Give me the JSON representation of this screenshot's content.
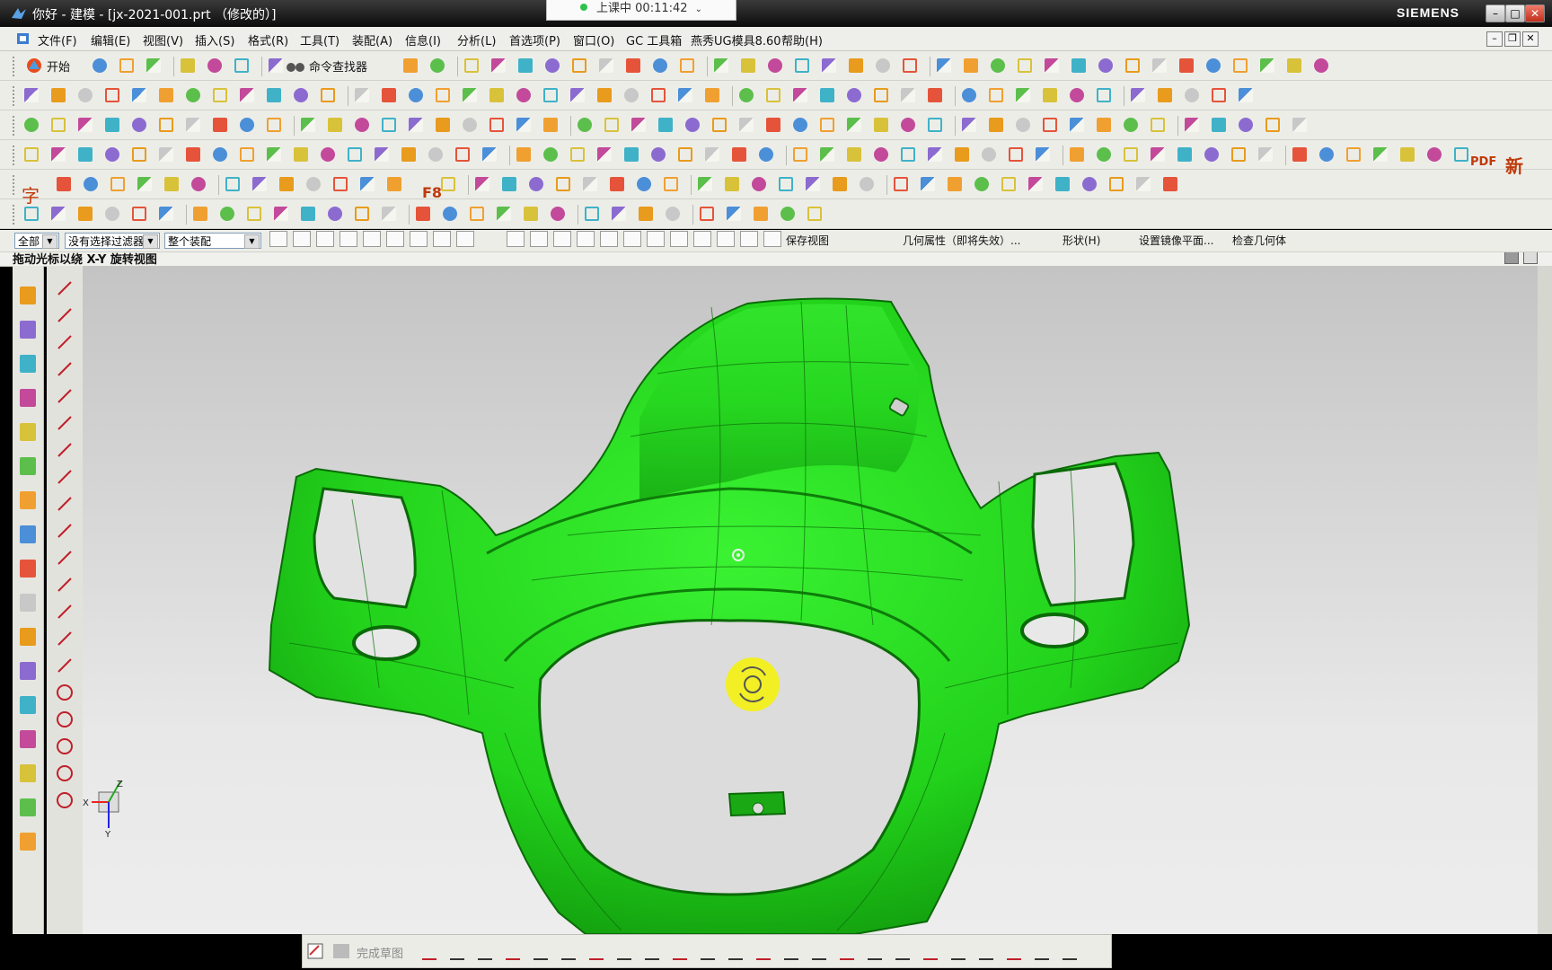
{
  "window": {
    "title": "你好 - 建模 - [jx-2021-001.prt （修改的）]",
    "brand": "SIEMENS",
    "meeting_status": "上课中 00:11:42"
  },
  "menu": {
    "items": [
      "文件(F)",
      "编辑(E)",
      "视图(V)",
      "插入(S)",
      "格式(R)",
      "工具(T)",
      "装配(A)",
      "信息(I)",
      "分析(L)",
      "首选项(P)",
      "窗口(O)",
      "GC 工具箱",
      "燕秀UG模具8.60",
      "帮助(H)"
    ]
  },
  "toolbar": {
    "start_label": "开始",
    "command_finder_label": "命令查找器",
    "pdf_label": "PDF",
    "new_label": "新",
    "f8_label": "F8",
    "zi_label": "字"
  },
  "selection_bar": {
    "filter_scope": "全部",
    "type_filter": "没有选择过滤器",
    "assembly_scope": "整个装配",
    "save_view_label": "保存视图",
    "geom_props_label": "几何属性（即将失效）...",
    "shape_label": "形状(H)",
    "mirror_plane_label": "设置镜像平面...",
    "check_geometry_label": "检查几何体"
  },
  "cue": {
    "text": "拖动光标以绕 X-Y 旋转视图"
  },
  "sketch_bar": {
    "finish_label": "完成草图"
  },
  "triad": {
    "x_label": "X",
    "y_label": "Y",
    "z_label": "Z"
  },
  "colors": {
    "part_green": "#22d61c",
    "part_green_dark": "#128a0e",
    "rotate_cursor": "#f2ef1a"
  }
}
